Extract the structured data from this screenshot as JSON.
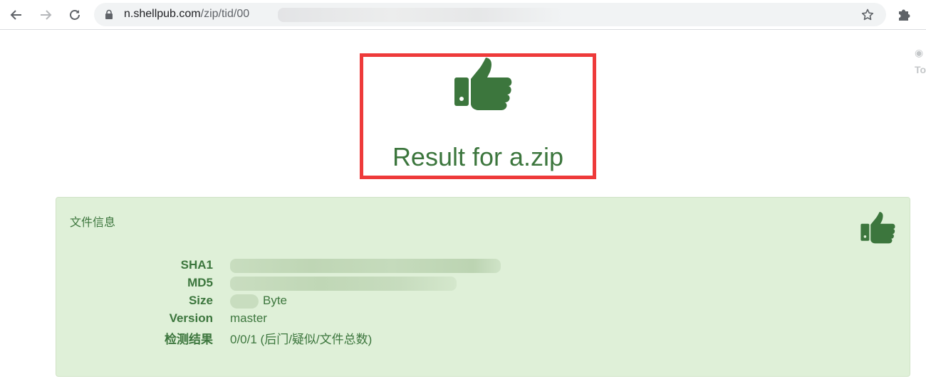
{
  "browser": {
    "url_host": "n.shellpub.com",
    "url_path": "/zip/tid/00",
    "side_partial_text": "To"
  },
  "header": {
    "title": "Result for a.zip",
    "accent_color": "#3c763d",
    "highlight_border_color": "#ee3a3a"
  },
  "panel": {
    "title": "文件信息",
    "background_color": "#dff0d8",
    "rows": [
      {
        "label": "SHA1",
        "value": ""
      },
      {
        "label": "MD5",
        "value": ""
      },
      {
        "label": "Size",
        "value": "Byte"
      },
      {
        "label": "Version",
        "value": "master"
      },
      {
        "label": "检测结果",
        "value": "0/0/1 (后门/疑似/文件总数)"
      }
    ]
  },
  "icons": {
    "back": "arrow-left-icon",
    "forward": "arrow-right-icon",
    "reload": "reload-icon",
    "lock": "lock-icon",
    "bookmark": "star-icon",
    "extensions": "puzzle-icon",
    "result": "thumbs-up-icon"
  }
}
